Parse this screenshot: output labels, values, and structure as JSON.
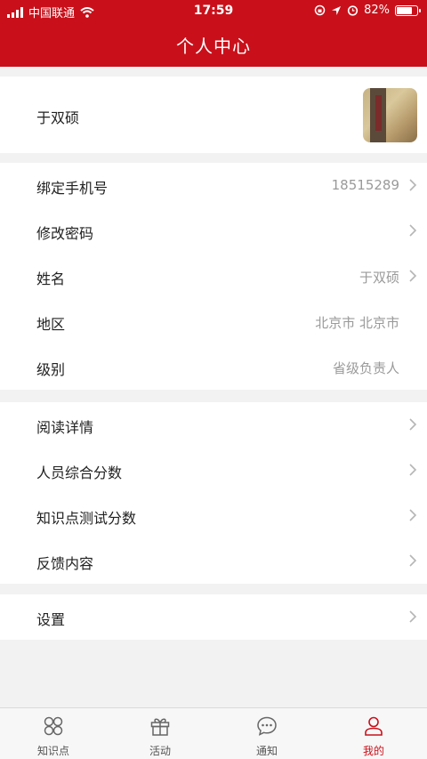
{
  "status_bar": {
    "carrier": "中国联通",
    "time": "17:59",
    "battery": "82%",
    "battery_level": 0.82
  },
  "header": {
    "title": "个人中心"
  },
  "profile": {
    "name": "于双硕"
  },
  "account": {
    "phone_label": "绑定手机号",
    "phone_value": "18515289",
    "password_label": "修改密码",
    "name_label": "姓名",
    "name_value": "于双硕",
    "region_label": "地区",
    "region_value": "北京市 北京市",
    "level_label": "级别",
    "level_value": "省级负责人"
  },
  "stats": {
    "reading_label": "阅读详情",
    "overall_score_label": "人员综合分数",
    "quiz_score_label": "知识点测试分数",
    "feedback_label": "反馈内容"
  },
  "settings": {
    "label": "设置"
  },
  "tabbar": {
    "tabs": [
      {
        "label": "知识点",
        "icon": "grid-icon"
      },
      {
        "label": "活动",
        "icon": "gift-icon"
      },
      {
        "label": "通知",
        "icon": "chat-bubble-icon"
      },
      {
        "label": "我的",
        "icon": "person-icon"
      }
    ],
    "active_color": "#c9101a"
  },
  "colors": {
    "brand": "#c9101a",
    "background": "#f2f2f2"
  }
}
